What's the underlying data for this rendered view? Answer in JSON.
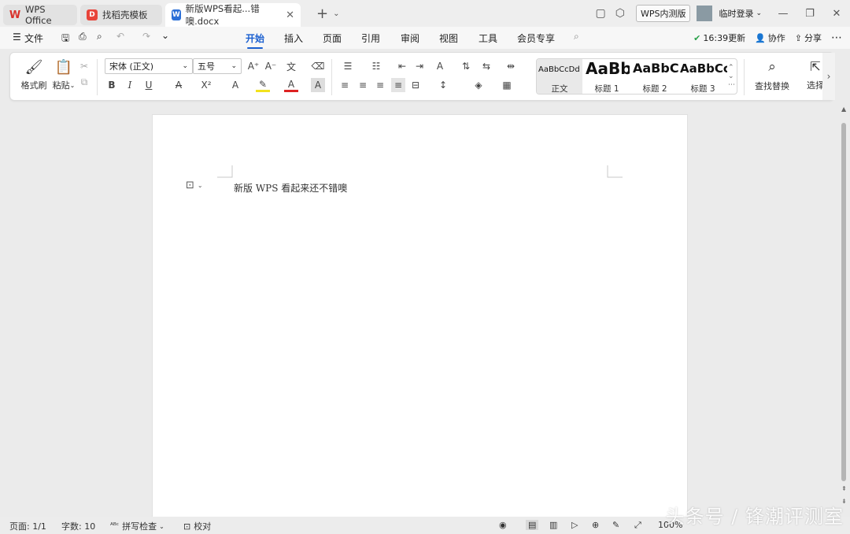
{
  "tabs": [
    {
      "label": "WPS Office",
      "icon": "wps-logo-icon",
      "color": "#d9322b"
    },
    {
      "label": "找稻壳模板",
      "icon": "docer-icon",
      "color": "#e8443a"
    },
    {
      "label": "新版WPS看起...错噢.docx",
      "icon": "word-doc-icon",
      "color": "#2b6fd7"
    }
  ],
  "titlebar": {
    "badge": "WPS内测版",
    "login": "临时登录"
  },
  "menu": {
    "file": "文件",
    "tabs": [
      "开始",
      "插入",
      "页面",
      "引用",
      "审阅",
      "视图",
      "工具",
      "会员专享"
    ],
    "active": "开始",
    "time": "16:39更新",
    "collab": "协作",
    "share": "分享"
  },
  "ribbon": {
    "format_painter": "格式刷",
    "paste": "粘贴",
    "font_name": "宋体 (正文)",
    "font_size": "五号",
    "styles": [
      {
        "preview": "AaBbCcDd",
        "label": "正文"
      },
      {
        "preview": "AaBb(",
        "label": "标题 1"
      },
      {
        "preview": "AaBbC",
        "label": "标题 2"
      },
      {
        "preview": "AaBbCc",
        "label": "标题 3"
      }
    ],
    "find_replace": "查找替换",
    "select": "选择"
  },
  "document": {
    "text": "新版 WPS 看起来还不错噢"
  },
  "status": {
    "page": "页面: 1/1",
    "words": "字数: 10",
    "spell": "拼写检查",
    "proof": "校对",
    "zoom": "100%"
  },
  "watermark": "头条号 / 锋潮评测室"
}
